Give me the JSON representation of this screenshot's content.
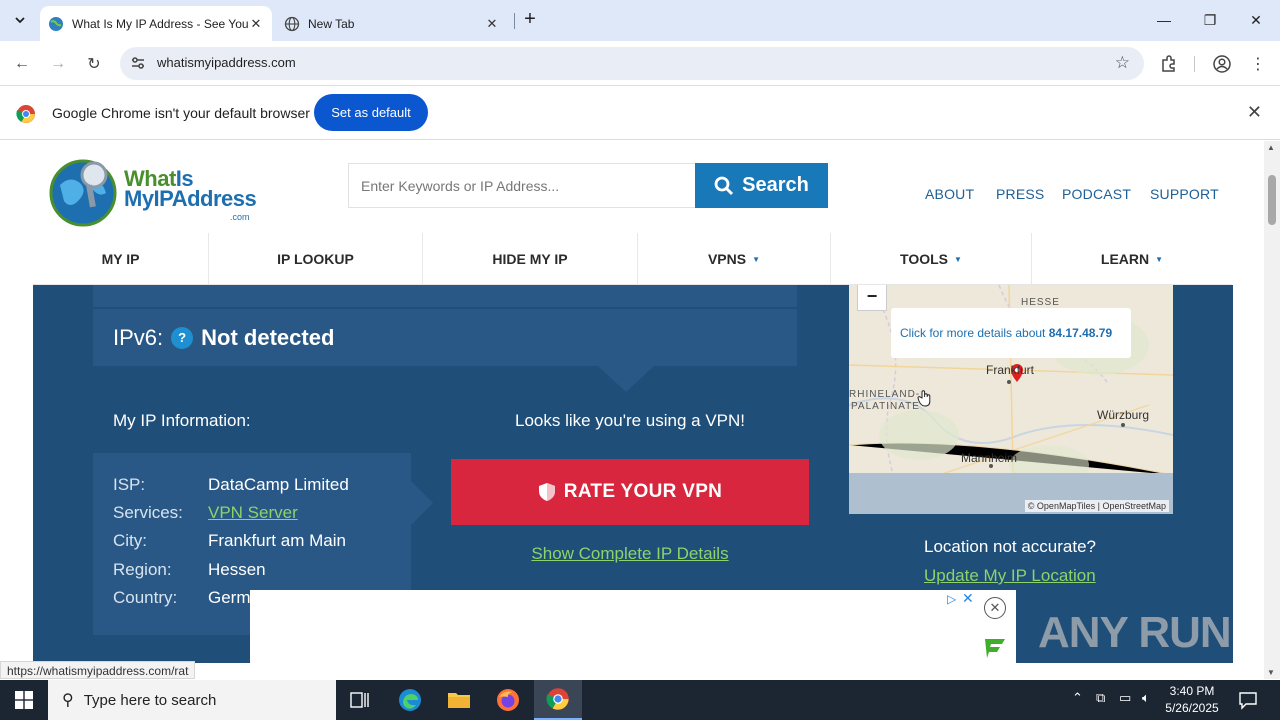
{
  "browser": {
    "tabs": [
      {
        "title": "What Is My IP Address - See Your",
        "active": true
      },
      {
        "title": "New Tab",
        "active": false
      }
    ],
    "url": "whatismyipaddress.com",
    "infobar": {
      "message": "Google Chrome isn't your default browser",
      "button": "Set as default"
    },
    "status_url": "https://whatismyipaddress.com/rat"
  },
  "site": {
    "logo": {
      "line1a": "What",
      "line1b": "Is",
      "line2": "MyIPAddress",
      "line3": ".com"
    },
    "search": {
      "placeholder": "Enter Keywords or IP Address...",
      "button": "Search"
    },
    "top_links": [
      "ABOUT",
      "PRESS",
      "PODCAST",
      "SUPPORT"
    ],
    "nav": [
      {
        "label": "MY IP",
        "dropdown": false
      },
      {
        "label": "IP LOOKUP",
        "dropdown": false
      },
      {
        "label": "HIDE MY IP",
        "dropdown": false
      },
      {
        "label": "VPNS",
        "dropdown": true
      },
      {
        "label": "TOOLS",
        "dropdown": true
      },
      {
        "label": "LEARN",
        "dropdown": true
      }
    ],
    "ipv6": {
      "label": "IPv6:",
      "help": "?",
      "value": "Not detected"
    },
    "info_title": "My IP Information:",
    "vpn_message": "Looks like you're using a VPN!",
    "info": [
      {
        "key": "ISP:",
        "value": "DataCamp Limited",
        "link": false
      },
      {
        "key": "Services:",
        "value": "VPN Server",
        "link": true
      },
      {
        "key": "City:",
        "value": "Frankfurt am Main",
        "link": false
      },
      {
        "key": "Region:",
        "value": "Hessen",
        "link": false
      },
      {
        "key": "Country:",
        "value": "Germany",
        "link": false
      }
    ],
    "rate_button": "RATE YOUR VPN",
    "show_details": "Show Complete IP Details",
    "map": {
      "zoom_out": "−",
      "popup_prefix": "Click for more details about ",
      "popup_ip": "84.17.48.79",
      "labels": {
        "hesse": "HESSE",
        "rhineland1": "RHINELAND-",
        "rhineland2": "PALATINATE",
        "frankfurt": "Frankfurt",
        "wurzburg": "Würzburg",
        "mannheim": "Mannheim"
      },
      "attribution": "© OpenMapTiles | OpenStreetMap"
    },
    "location_question": "Location not accurate?",
    "location_link": "Update My IP Location"
  },
  "taskbar": {
    "search_placeholder": "Type here to search",
    "time": "3:40 PM",
    "date": "5/26/2025"
  },
  "watermark": "ANY RUN",
  "colors": {
    "site_blue": "#1f4e79",
    "accent_green": "#8ed26b",
    "vpn_red": "#d7263d",
    "search_blue": "#1978b8"
  }
}
